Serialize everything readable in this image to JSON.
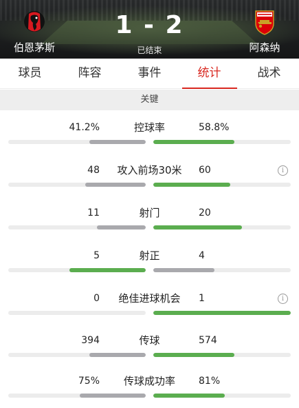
{
  "match": {
    "home_team": "伯恩茅斯",
    "away_team": "阿森纳",
    "score": "1 - 2",
    "status": "已结束"
  },
  "tabs": [
    {
      "label": "球员",
      "active": false
    },
    {
      "label": "阵容",
      "active": false
    },
    {
      "label": "事件",
      "active": false
    },
    {
      "label": "统计",
      "active": true
    },
    {
      "label": "战术",
      "active": false
    }
  ],
  "section": {
    "title": "关键"
  },
  "stats": [
    {
      "label": "控球率",
      "home": "41.2%",
      "away": "58.8%",
      "home_fill": 0.412,
      "away_fill": 0.588,
      "home_color": "gray",
      "away_color": "green",
      "info": false
    },
    {
      "label": "攻入前场30米",
      "home": "48",
      "away": "60",
      "home_fill": 0.44,
      "away_fill": 0.56,
      "home_color": "gray",
      "away_color": "green",
      "info": true
    },
    {
      "label": "射门",
      "home": "11",
      "away": "20",
      "home_fill": 0.355,
      "away_fill": 0.645,
      "home_color": "gray",
      "away_color": "green",
      "info": false
    },
    {
      "label": "射正",
      "home": "5",
      "away": "4",
      "home_fill": 0.556,
      "away_fill": 0.444,
      "home_color": "green",
      "away_color": "gray",
      "info": false
    },
    {
      "label": "绝佳进球机会",
      "home": "0",
      "away": "1",
      "home_fill": 0.0,
      "away_fill": 1.0,
      "home_color": "gray",
      "away_color": "green",
      "info": true
    },
    {
      "label": "传球",
      "home": "394",
      "away": "574",
      "home_fill": 0.41,
      "away_fill": 0.59,
      "home_color": "gray",
      "away_color": "green",
      "info": false
    },
    {
      "label": "传球成功率",
      "home": "75%",
      "away": "81%",
      "home_fill": 0.48,
      "away_fill": 0.52,
      "home_color": "gray",
      "away_color": "green",
      "info": false
    }
  ],
  "colors": {
    "accent": "#d8261e",
    "bar_green": "#5bad4f",
    "bar_gray": "#a9a9ad",
    "track": "#ececec"
  },
  "icons": {
    "info": "info-icon",
    "home_badge": "bournemouth-badge-icon",
    "away_badge": "arsenal-badge-icon"
  }
}
